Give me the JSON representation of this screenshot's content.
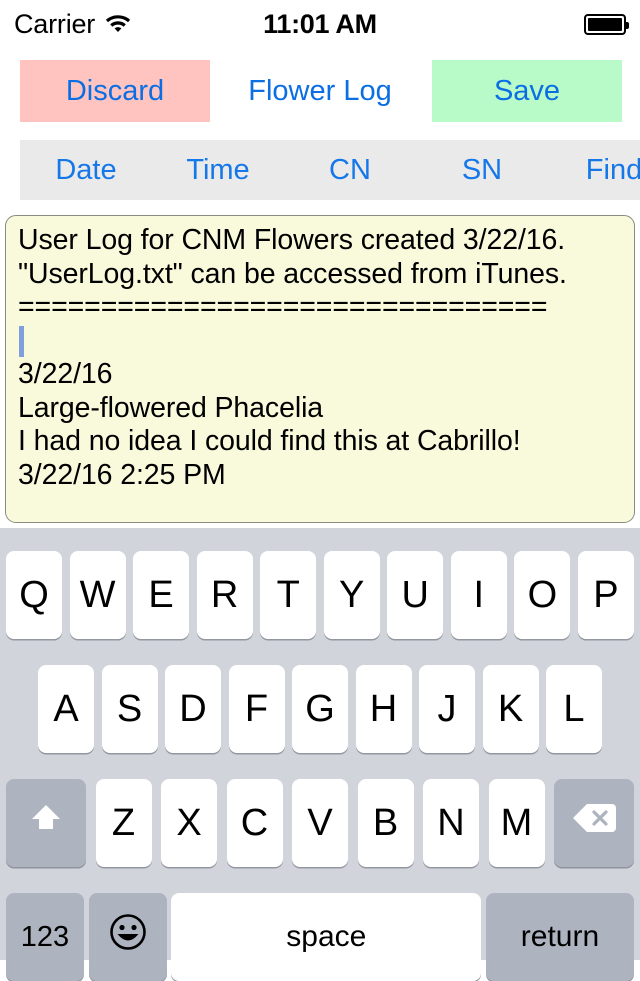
{
  "status_bar": {
    "carrier": "Carrier",
    "wifi_icon": "wifi-icon",
    "time": "11:01 AM",
    "battery_icon": "battery-full-icon"
  },
  "toolbar_top": {
    "discard_label": "Discard",
    "title_label": "Flower Log",
    "save_label": "Save",
    "discard_bg": "#FFC4C0",
    "save_bg": "#B8FBC9",
    "text_color": "#0B6EE3"
  },
  "toolbar_tags": {
    "buttons": [
      {
        "label": "Date",
        "name": "date-button"
      },
      {
        "label": "Time",
        "name": "time-button"
      },
      {
        "label": "CN",
        "name": "cn-button"
      },
      {
        "label": "SN",
        "name": "sn-button"
      },
      {
        "label": "Find",
        "name": "find-button"
      }
    ],
    "bg": "#EAEAEA",
    "text_color": "#1678E8"
  },
  "log_textarea": {
    "background": "#F8FADB",
    "lines": [
      "User Log for CNM Flowers created 3/22/16.",
      "\"UserLog.txt\" can be accessed from iTunes.",
      "================================",
      "",
      "3/22/16",
      "Large-flowered Phacelia",
      "I had no idea I could find this at Cabrillo!",
      "",
      "3/22/16 2:25 PM"
    ],
    "caret_line_index": 3,
    "caret_color": "#7F9FDD"
  },
  "keyboard": {
    "background": "#D1D4DB",
    "row1": [
      "Q",
      "W",
      "E",
      "R",
      "T",
      "Y",
      "U",
      "I",
      "O",
      "P"
    ],
    "row2": [
      "A",
      "S",
      "D",
      "F",
      "G",
      "H",
      "J",
      "K",
      "L"
    ],
    "row3_letters": [
      "Z",
      "X",
      "C",
      "V",
      "B",
      "N",
      "M"
    ],
    "shift_icon": "shift-arrow-icon",
    "delete_icon": "backspace-delete-icon",
    "numeric_label": "123",
    "emoji_icon": "smiley-face-icon",
    "space_label": "space",
    "return_label": "return",
    "key_bg": "#FFFFFF",
    "modifier_key_bg": "#ADB3BF"
  }
}
